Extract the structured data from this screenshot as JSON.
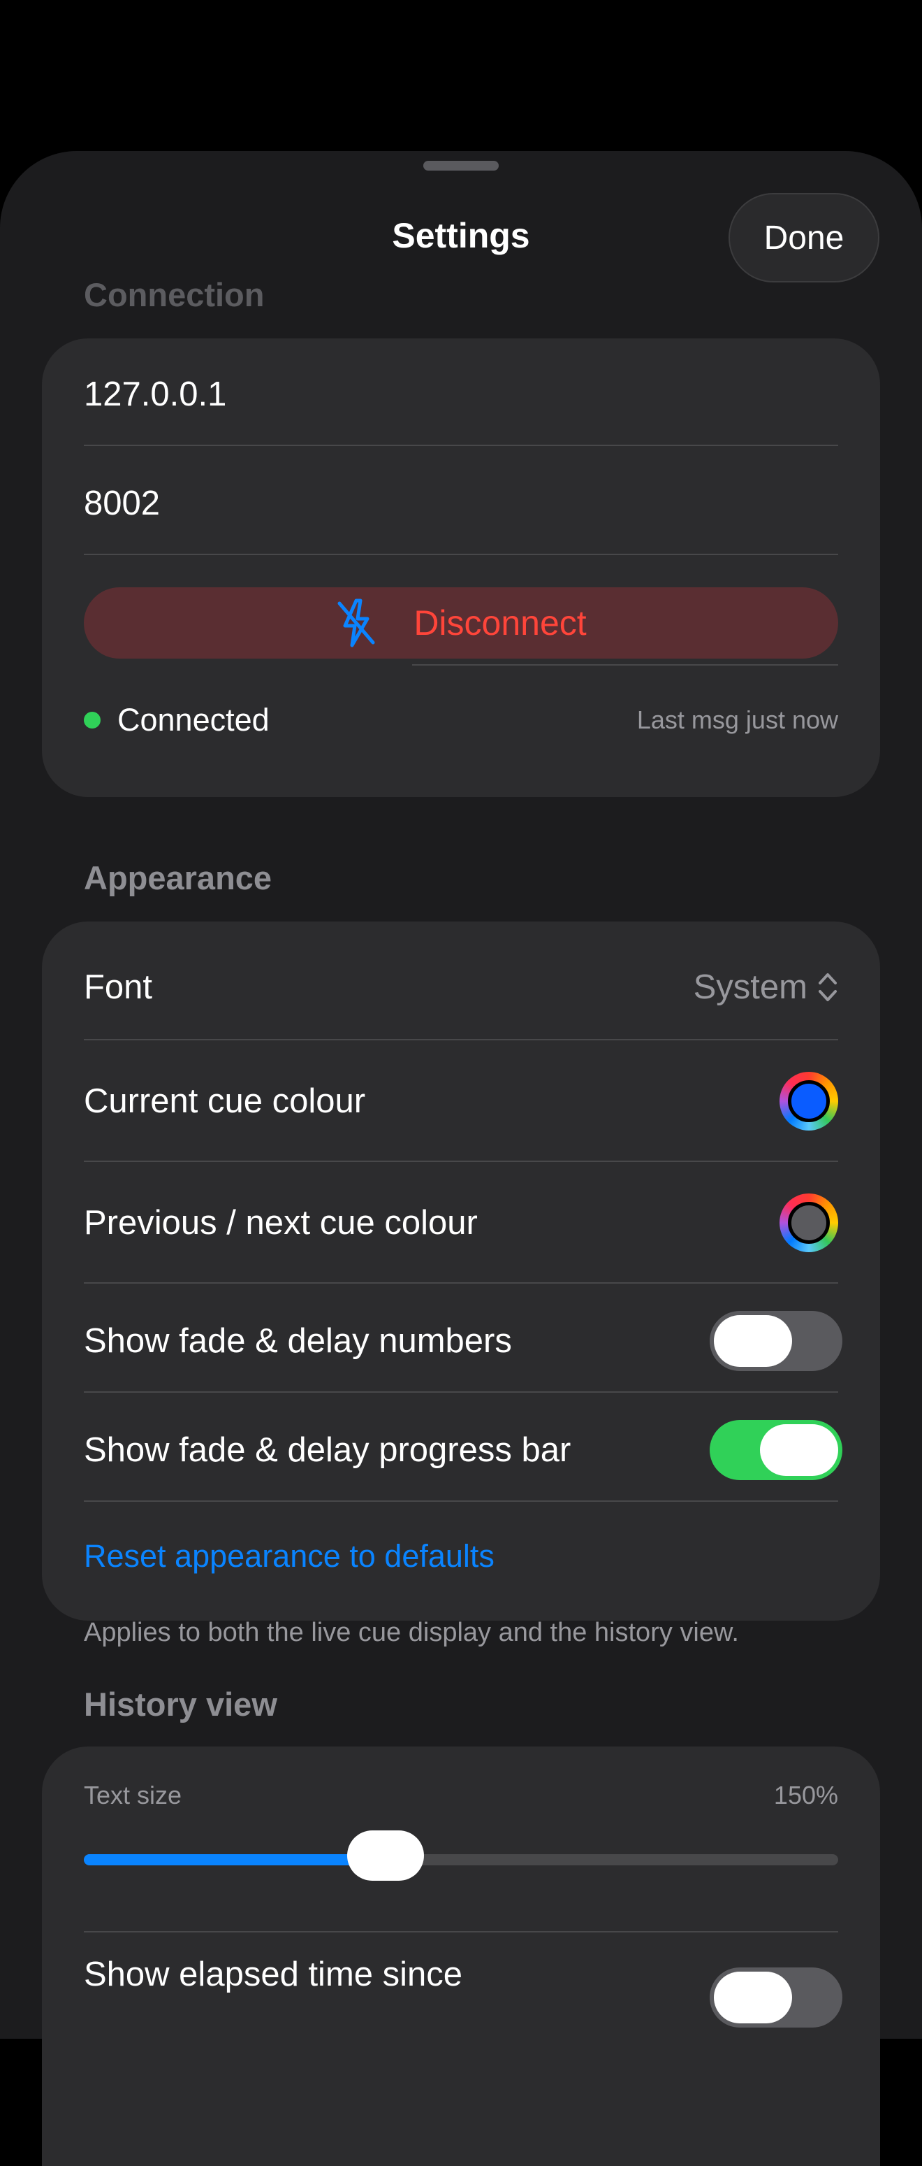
{
  "header": {
    "title": "Settings",
    "done_label": "Done"
  },
  "connection": {
    "section_title": "Connection",
    "host": "127.0.0.1",
    "port": "8002",
    "disconnect_label": "Disconnect",
    "status_label": "Connected",
    "last_message": "Last msg just now",
    "status_color": "#30d158"
  },
  "appearance": {
    "section_title": "Appearance",
    "font_label": "Font",
    "font_value": "System",
    "current_cue_label": "Current cue colour",
    "current_cue_color": "#0a5cff",
    "prev_next_cue_label": "Previous / next cue colour",
    "prev_next_cue_color": "#5a5a5e",
    "show_numbers_label": "Show fade & delay numbers",
    "show_numbers_on": false,
    "show_progress_label": "Show fade & delay progress bar",
    "show_progress_on": true,
    "reset_label": "Reset appearance to defaults",
    "footnote": "Applies to both the live cue display and the history view."
  },
  "history": {
    "section_title": "History view",
    "text_size_label": "Text size",
    "text_size_value": "150%",
    "text_size_fraction": 0.4,
    "elapsed_label": "Show elapsed time since",
    "elapsed_on": false
  },
  "icons": {
    "disconnect": "bolt-slash-icon",
    "font_picker": "chevron-up-down-icon"
  }
}
